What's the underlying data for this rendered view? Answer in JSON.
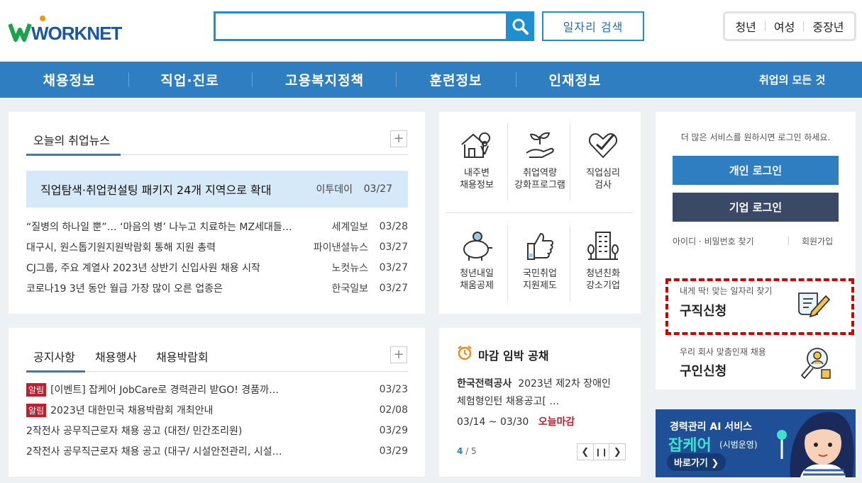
{
  "header": {
    "logo_text": "WORKNET",
    "search_button_label": "일자리 검색",
    "target_links": [
      "청년",
      "여성",
      "중장년"
    ]
  },
  "gnb": {
    "items": [
      "채용정보",
      "직업·진로",
      "고용복지정책",
      "훈련정보",
      "인재정보"
    ],
    "all_label": "취업의 모든 것"
  },
  "news": {
    "tab_title": "오늘의 취업뉴스",
    "more_label": "+",
    "highlight": {
      "title": "직업탐색·취업컨설팅 패키지 24개 지역으로 확대",
      "source": "이투데이",
      "date": "03/27"
    },
    "items": [
      {
        "title": "“질병의 하나일 뿐”… ‘마음의 병’ 나누고 치료하는 MZ세대들…",
        "source": "세계일보",
        "date": "03/28"
      },
      {
        "title": "대구시, 원스톱기원지원박람회 통해 지원 총력",
        "source": "파이낸셜뉴스",
        "date": "03/27"
      },
      {
        "title": "CJ그룹, 주요 계열사 2023년 상반기 신입사원 채용 시작",
        "source": "노컷뉴스",
        "date": "03/27"
      },
      {
        "title": "코로나19 3년 동안 월급 가장 많이 오른 업종은",
        "source": "한국일보",
        "date": "03/27"
      }
    ]
  },
  "services": [
    {
      "line1": "내주변",
      "line2": "채용정보",
      "icon": "house-location-icon"
    },
    {
      "line1": "취업역량",
      "line2": "강화프로그램",
      "icon": "sprout-hand-icon"
    },
    {
      "line1": "직업심리",
      "line2": "검사",
      "icon": "heart-check-icon"
    },
    {
      "line1": "청년내일",
      "line2": "채움공제",
      "icon": "piggy-bank-icon"
    },
    {
      "line1": "국민취업",
      "line2": "지원제도",
      "icon": "thumbs-up-icon"
    },
    {
      "line1": "청년친화",
      "line2": "강소기업",
      "icon": "building-icon"
    }
  ],
  "notice": {
    "tabs": [
      "공지사항",
      "채용행사",
      "채용박람회"
    ],
    "more_label": "+",
    "badge_label": "알림",
    "items": [
      {
        "badge": true,
        "title": "[이벤트] 잡케어 JobCare로 경력관리 받GO! 경품까…",
        "date": "03/23"
      },
      {
        "badge": true,
        "title": "2023년 대한민국 채용박람회 개최안내",
        "date": "02/08"
      },
      {
        "badge": false,
        "title": "2작전사 공무직근로자 채용 공고 (대전/ 민간조리원)",
        "date": "03/29"
      },
      {
        "badge": false,
        "title": "2작전사 공무직근로자 채용 공고 (대구/ 시설안전관리, 시설…",
        "date": "03/29"
      }
    ]
  },
  "deadline": {
    "title": "마감 임박 공채",
    "company": "한국전력공사",
    "desc1": "2023년 제2차 장애인",
    "desc2": "체험형인턴 채용공고[ …",
    "period": "03/14 ~ 03/30",
    "status": "오늘마감",
    "page_current": "4",
    "page_total": "/ 5"
  },
  "login": {
    "notice": "더 많은 서비스를 원하시면 로그인 하세요.",
    "personal_login": "개인 로그인",
    "company_login": "기업 로그인",
    "find_id_pw": "아이디 · 비밀번호 찾기",
    "join": "회원가입",
    "job_apply_sub": "내게 딱! 맞는 일자리 찾기",
    "job_apply": "구직신청",
    "recruit_sub": "우리 회사 맞춤인재 채용",
    "recruit": "구인신청"
  },
  "ad": {
    "line1": "경력관리 AI 서비스",
    "brand": "잡케어",
    "trial": "(시범운영)",
    "go": "바로가기 ❯"
  },
  "colors": {
    "primary": "#2f7ec2",
    "search_border": "#1f8fd0",
    "dark_button": "#3a4a66",
    "alert_red": "#c01f2f",
    "highlight_red": "#d40000"
  }
}
